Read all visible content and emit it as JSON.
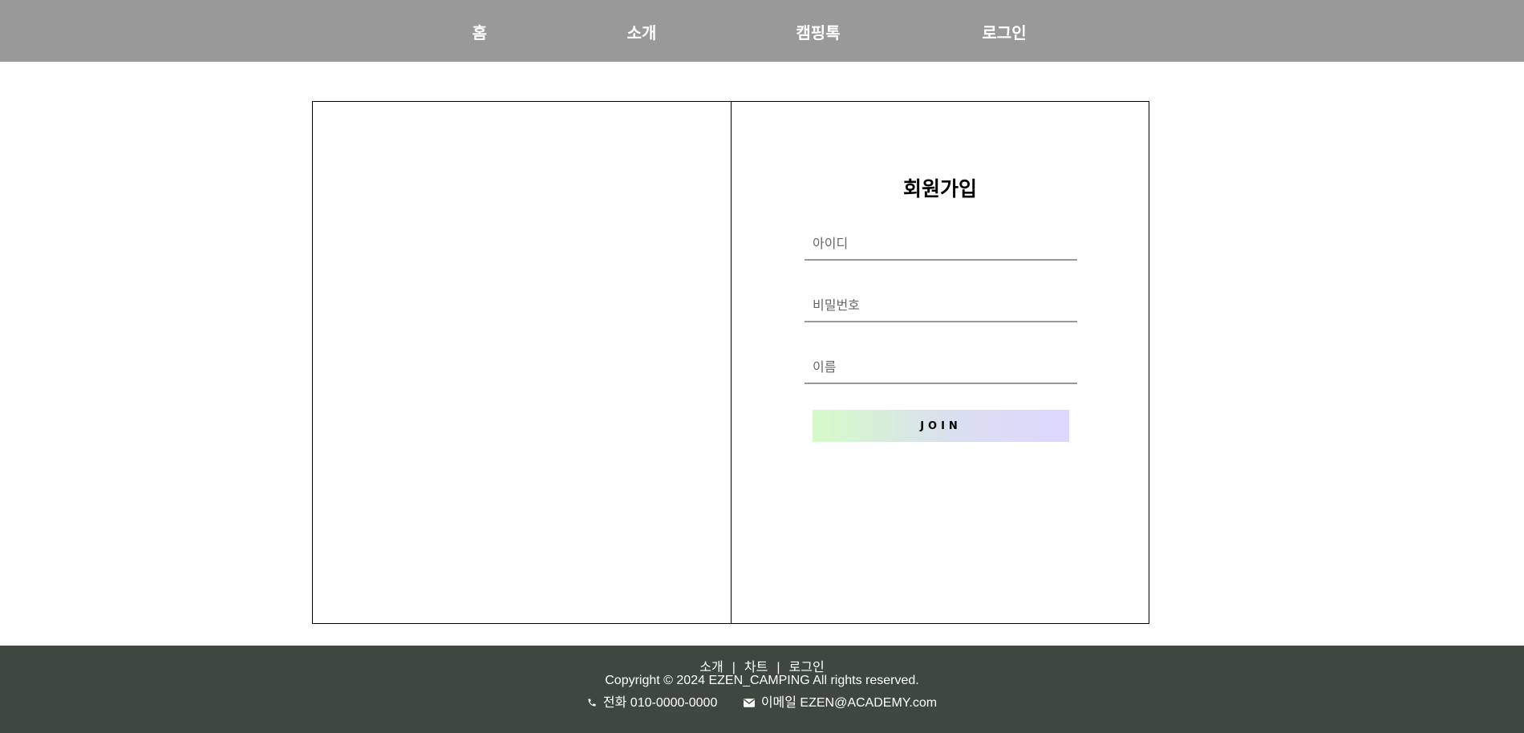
{
  "nav": {
    "items": [
      {
        "label": "홈"
      },
      {
        "label": "소개"
      },
      {
        "label": "캠핑톡"
      },
      {
        "label": "로그인"
      }
    ]
  },
  "signup": {
    "title": "회원가입",
    "id_placeholder": "아이디",
    "password_placeholder": "비밀번호",
    "name_placeholder": "이름",
    "join_label": "JOIN"
  },
  "footer": {
    "links": [
      {
        "label": "소개"
      },
      {
        "label": "차트"
      },
      {
        "label": "로그인"
      }
    ],
    "separator": "|",
    "copyright": "Copyright © 2024 EZEN_CAMPING All rights reserved.",
    "phone_text": "전화 010-0000-0000",
    "email_text": "이메일 EZEN@ACADEMY.com",
    "icons": {
      "phone": "phone-icon",
      "email": "mail-icon"
    }
  },
  "colors": {
    "header_bg": "#999999",
    "footer_bg": "#3e483e",
    "join_gradient_start": "#d5fbc8",
    "join_gradient_end": "#ddd6fe"
  }
}
